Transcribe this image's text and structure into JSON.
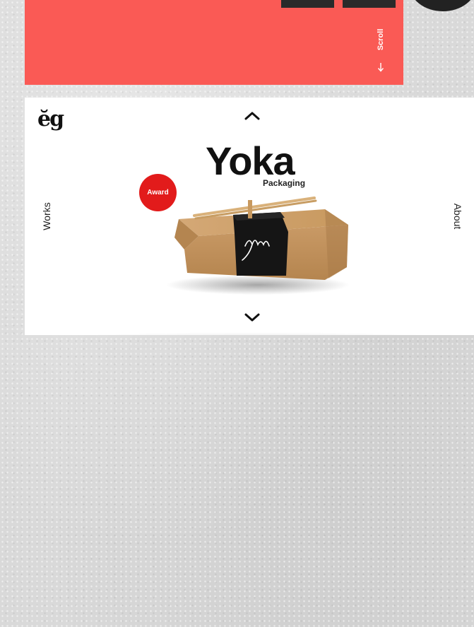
{
  "hero": {
    "scroll_label": "Scroll",
    "scroll_icon": "arrow-down-icon",
    "accent_color": "#fa5a55"
  },
  "brand": {
    "logo_text": "ĕg"
  },
  "navigation": {
    "up_icon": "chevron-up-icon",
    "down_icon": "chevron-down-icon",
    "left_label": "Works",
    "right_label": "About"
  },
  "project": {
    "title": "Yoka",
    "subtitle": "Packaging",
    "badge": "Award",
    "badge_color": "#e21b1b",
    "brand_mark_on_box": "yoka"
  }
}
